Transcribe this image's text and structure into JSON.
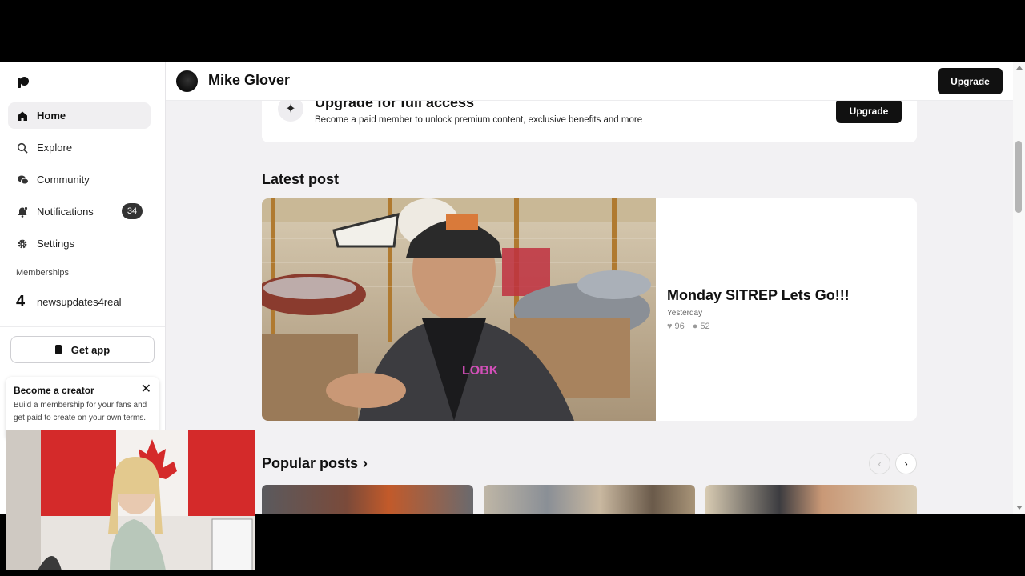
{
  "sidebar": {
    "nav": [
      {
        "label": "Home",
        "icon": "home-icon",
        "active": true
      },
      {
        "label": "Explore",
        "icon": "search-icon"
      },
      {
        "label": "Community",
        "icon": "chat-bubbles-icon"
      },
      {
        "label": "Notifications",
        "icon": "bell-icon",
        "badge": "34"
      },
      {
        "label": "Settings",
        "icon": "gear-icon"
      }
    ],
    "memberships_label": "Memberships",
    "membership": {
      "glyph": "4",
      "label": "newsupdates4real"
    },
    "get_app_label": "Get app",
    "creator_card": {
      "title": "Become a creator",
      "description": "Build a membership for your fans and get paid to create on your own terms."
    }
  },
  "header": {
    "creator_name": "Mike Glover",
    "upgrade_label": "Upgrade"
  },
  "banner": {
    "title": "Upgrade for full access",
    "description": "Become a paid member to unlock premium content, exclusive benefits and more",
    "upgrade_label": "Upgrade"
  },
  "latest": {
    "heading": "Latest post",
    "post": {
      "title": "Monday SITREP Lets Go!!!",
      "date": "Yesterday",
      "likes": "96",
      "comments": "52"
    }
  },
  "popular": {
    "heading": "Popular posts"
  },
  "colors": {
    "accent": "#111111",
    "page_bg": "#f2f1f3",
    "card_bg": "#ffffff"
  }
}
